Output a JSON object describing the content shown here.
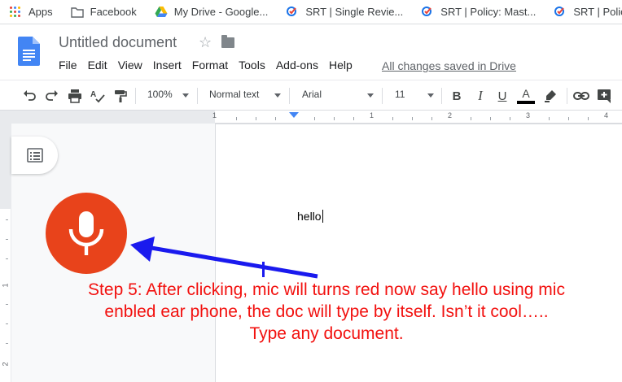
{
  "bookmarks": [
    {
      "label": "Apps",
      "icon": "apps-grid-icon"
    },
    {
      "label": "Facebook",
      "icon": "folder-icon"
    },
    {
      "label": "My Drive - Google...",
      "icon": "google-drive-icon"
    },
    {
      "label": "SRT | Single Revie...",
      "icon": "srt-icon"
    },
    {
      "label": "SRT | Policy: Mast...",
      "icon": "srt-icon"
    },
    {
      "label": "SRT | Policy: Regu",
      "icon": "srt-icon"
    }
  ],
  "doc": {
    "title": "Untitled document",
    "saved_status": "All changes saved in Drive",
    "body_text": "hello"
  },
  "menu": [
    "File",
    "Edit",
    "View",
    "Insert",
    "Format",
    "Tools",
    "Add-ons",
    "Help"
  ],
  "toolbar": {
    "zoom": "100%",
    "style": "Normal text",
    "font": "Arial",
    "size": "11"
  },
  "ruler": {
    "h_labels": [
      "1",
      "1",
      "2",
      "3",
      "4"
    ],
    "v_labels": [
      "1",
      "2"
    ]
  },
  "caption": {
    "line1": "Step 5: After clicking, mic will turns red now say hello using mic",
    "line2": "enbled ear phone, the doc will type by itself. Isn’t it cool…..",
    "line3": "Type any document."
  },
  "colors": {
    "mic": "#e8431b",
    "caption": "#f2110f",
    "arrow": "#1a1aee",
    "docs_blue": "#4285f4"
  }
}
